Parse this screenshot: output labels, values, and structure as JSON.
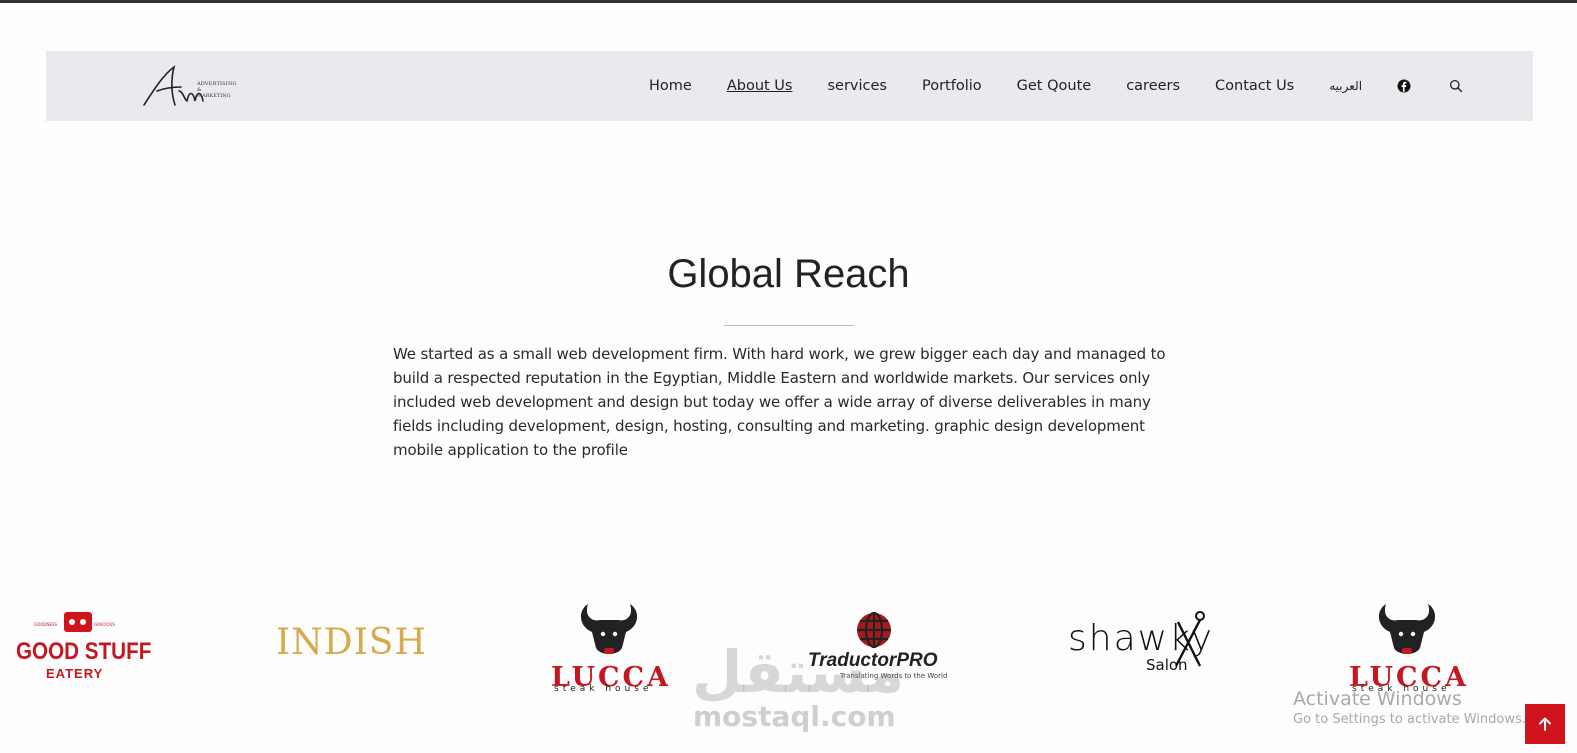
{
  "brand": {
    "logo_text": "AM",
    "logo_subtitle_1": "ADVERTISING",
    "logo_subtitle_2": "& MARKETING"
  },
  "nav": {
    "items": [
      {
        "label": "Home",
        "active": false
      },
      {
        "label": "About Us",
        "active": true
      },
      {
        "label": "services",
        "active": false
      },
      {
        "label": "Portfolio",
        "active": false
      },
      {
        "label": "Get Qoute",
        "active": false
      },
      {
        "label": "careers",
        "active": false
      },
      {
        "label": "Contact Us",
        "active": false
      },
      {
        "label": "العربيه",
        "active": false
      }
    ],
    "icons": [
      "facebook-icon",
      "search-icon"
    ]
  },
  "section": {
    "title": "Global Reach",
    "body": "We started as a small web development firm. With hard work, we grew bigger each day and managed to build a respected reputation in the Egyptian, Middle Eastern and worldwide markets. Our services only included web development and design but today we offer a wide array of diverse deliverables in many fields including development, design, hosting, consulting and marketing. graphic design development mobile application to the profile"
  },
  "clients": [
    {
      "name": "GOOD STUFF",
      "sub": "EATERY",
      "tag_left": "GOODNESS",
      "tag_right": "GRACIOUS"
    },
    {
      "name": "INDISH"
    },
    {
      "name": "LUCCA",
      "sub": "steak house"
    },
    {
      "name": "TraductorPRO",
      "sub": "Translating Words to the World"
    },
    {
      "name": "shawky",
      "sub": "Salon"
    },
    {
      "name": "LUCCA",
      "sub": "steak house"
    }
  ],
  "watermark": {
    "arabic": "مستقل",
    "latin": "mostaql.com"
  },
  "os_overlay": {
    "line1": "Activate Windows",
    "line2": "Go to Settings to activate Windows."
  },
  "back_to_top_icon": "arrow-up-icon",
  "colors": {
    "brand_red": "#d0141d",
    "indish_gold": "#d9aa4a",
    "navbar_bg": "#e9eaed"
  }
}
